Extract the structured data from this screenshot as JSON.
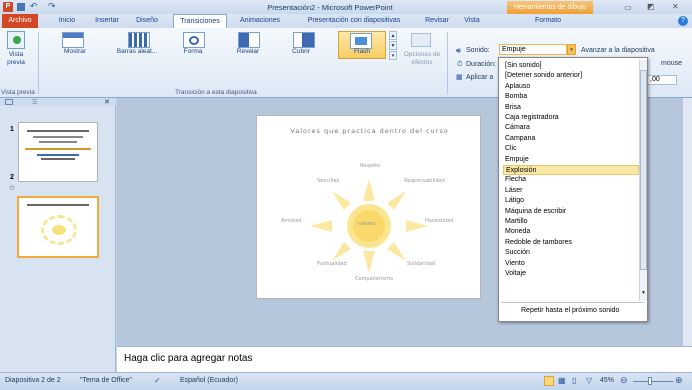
{
  "title": "Presentación2 - Microsoft PowerPoint",
  "contextual_tab": "Herramientas de dibujo",
  "tabs": [
    "Archivo",
    "Inicio",
    "Insertar",
    "Diseño",
    "Transiciones",
    "Animaciones",
    "Presentación con diapositivas",
    "Revisar",
    "Vista",
    "Formato"
  ],
  "ribbon": {
    "preview": "Vista previa",
    "preview_group": "Vista previa",
    "transitions": [
      "Mostrar",
      "Barras aleat...",
      "Forma",
      "Revelar",
      "Cubrir",
      "Flash"
    ],
    "effect_options": "Opciones de efectos",
    "group_label": "Transición a esta diapositiva",
    "sound_label": "Sonido:",
    "sound_value": "Empuje",
    "duration_label": "Duración:",
    "apply_label": "Aplicar a",
    "advance_label": "Avanzar a la diapositiva",
    "mouse_label": "mouse",
    "time_value": ",00"
  },
  "dropdown_items": [
    "[Sin sonido]",
    "[Detener sonido anterior]",
    "Aplauso",
    "Bomba",
    "Brisa",
    "Caja registradora",
    "Cámara",
    "Campana",
    "Clic",
    "Empuje",
    "Explosión",
    "Flecha",
    "Láser",
    "Látigo",
    "Máquina de escribir",
    "Martillo",
    "Moneda",
    "Redoble de tambores",
    "Succión",
    "Viento",
    "Voltaje"
  ],
  "dropdown_footer": "Repetir hasta el próximo sonido",
  "slide": {
    "title": "Valores que  practica dentro del curso",
    "center": "valores",
    "labels": [
      "Respeto",
      "Sencillez",
      "Responsabilidad",
      "Amistad",
      "Honestidad",
      "Puntualidad",
      "Solidaridad",
      "Compañerismo"
    ]
  },
  "thumbs": [
    "1",
    "2"
  ],
  "notes_placeholder": "Haga clic para agregar notas",
  "status": {
    "slide": "Diapositiva 2 de 2",
    "theme": "\"Tema de Office\"",
    "lang": "Español (Ecuador)",
    "zoom": "45%"
  }
}
